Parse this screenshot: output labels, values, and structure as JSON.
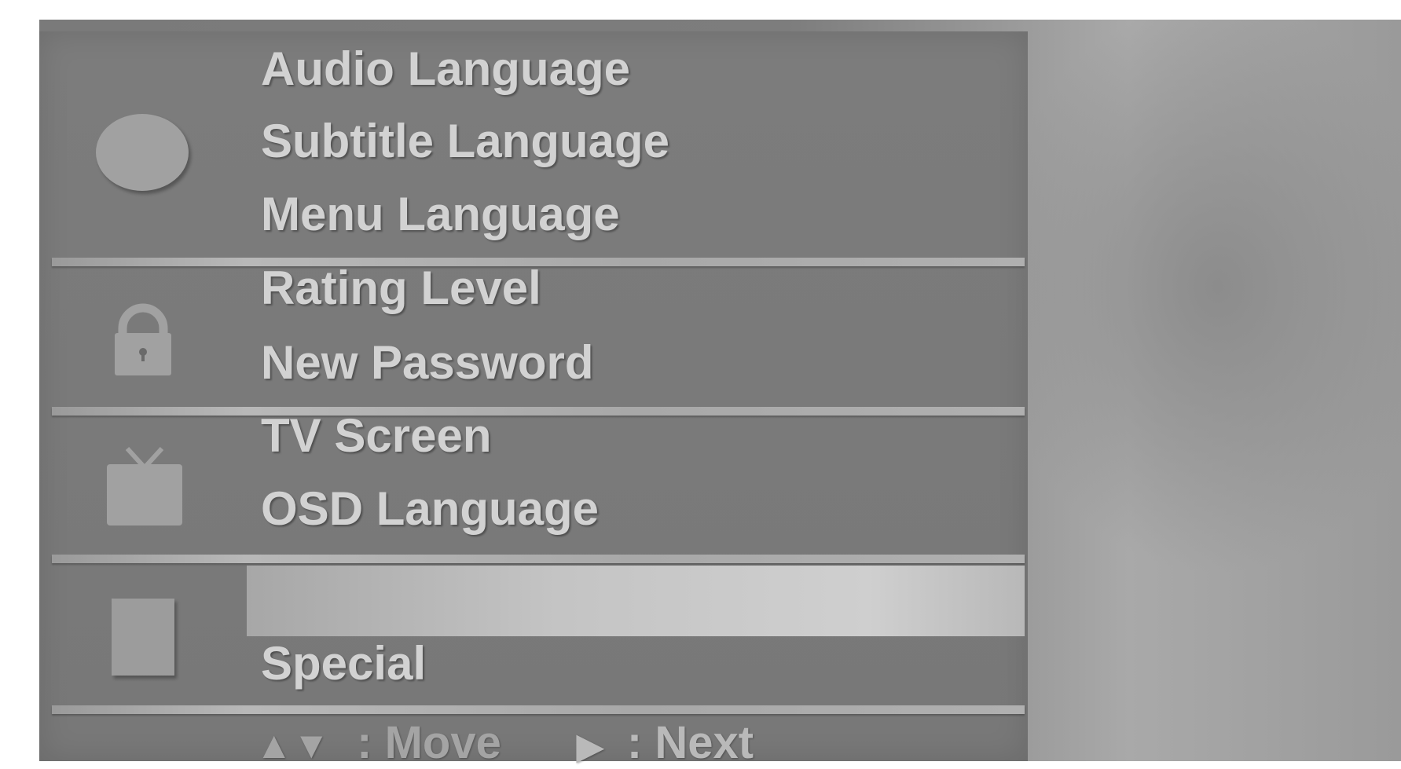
{
  "menu": {
    "groups": [
      {
        "icon": "disc-icon",
        "items": [
          "Audio Language",
          "Subtitle Language",
          "Menu Language"
        ]
      },
      {
        "icon": "lock-icon",
        "items": [
          "Rating Level",
          "New Password"
        ]
      },
      {
        "icon": "tv-icon",
        "items": [
          "TV Screen",
          "OSD Language"
        ]
      },
      {
        "icon": "others-icon",
        "items": [
          "",
          "Special"
        ]
      }
    ],
    "selected_item": "highlighted empty row in others group"
  },
  "footer": {
    "move_symbol": "▲▼",
    "move_label": ": Move",
    "next_symbol": "▶",
    "next_label": ": Next"
  }
}
